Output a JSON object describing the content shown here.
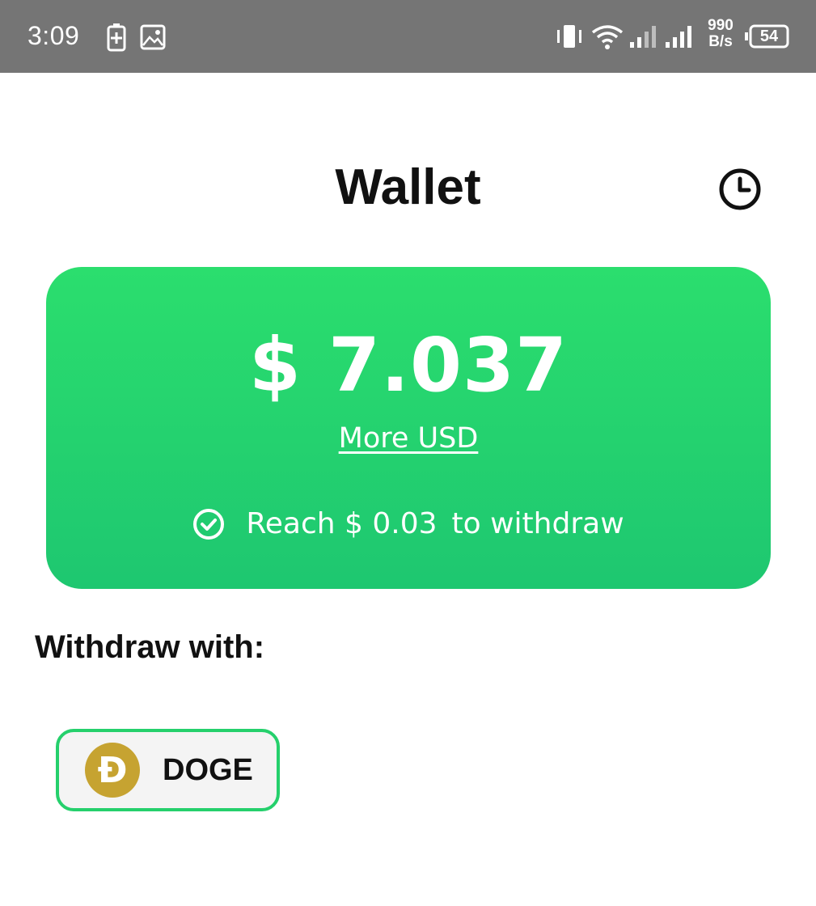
{
  "status_bar": {
    "time": "3:09",
    "speed_value": "990",
    "speed_unit": "B/s",
    "battery_level": "54",
    "icons": [
      "battery-saver-icon",
      "gallery-icon",
      "vibrate-icon",
      "wifi-icon",
      "signal-sim1-icon",
      "signal-sim2-icon",
      "battery-icon"
    ]
  },
  "header": {
    "title": "Wallet",
    "history_icon": "clock-icon"
  },
  "balance_card": {
    "amount": "$ 7.037",
    "more_link": "More USD",
    "reach_prefix": "Reach $ 0.03",
    "reach_suffix": "to withdraw",
    "check_icon": "check-circle-icon",
    "gradient_top": "#2bde6e",
    "gradient_bottom": "#1ec770"
  },
  "withdraw": {
    "label": "Withdraw with:",
    "methods": [
      {
        "coin_symbol": "Ð",
        "label": "DOGE",
        "coin_color": "#c6a331",
        "border_color": "#25d06c"
      }
    ]
  }
}
